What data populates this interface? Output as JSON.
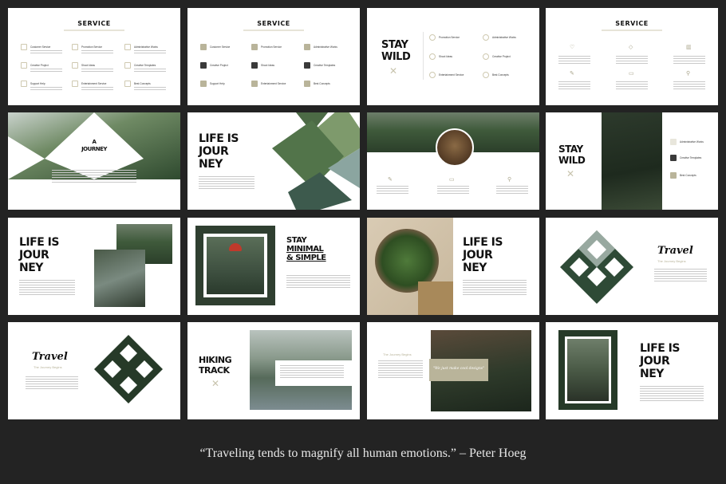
{
  "slides": {
    "service_title": "SERVICE",
    "service_items": [
      "Customer Service",
      "Promotion Service",
      "Administrative Works",
      "Creative Project",
      "Shoot Ideas",
      "Creative Templates",
      "Support Help",
      "Entertainment Service",
      "Best Concepts"
    ],
    "stay_wild": [
      "STAY",
      "WILD"
    ],
    "a_journey": [
      "A",
      "JOURNEY"
    ],
    "life_is_journey": [
      "LIFE IS",
      "JOUR",
      "NEY"
    ],
    "stay_minimal": [
      "STAY",
      "MINIMAL",
      "& SIMPLE"
    ],
    "travel": "Travel",
    "travel_sub": "The Journey Begins",
    "hiking_track": [
      "HIKING",
      "TRACK"
    ],
    "journey_begins": "The Journey Begins",
    "cool_designs": "\"We just make cool designs\""
  },
  "quote": "“Traveling tends to magnify all human emotions.” – Peter Hoeg",
  "colors": {
    "background": "#232323",
    "accent": "#b9b49a",
    "text": "#111111"
  }
}
